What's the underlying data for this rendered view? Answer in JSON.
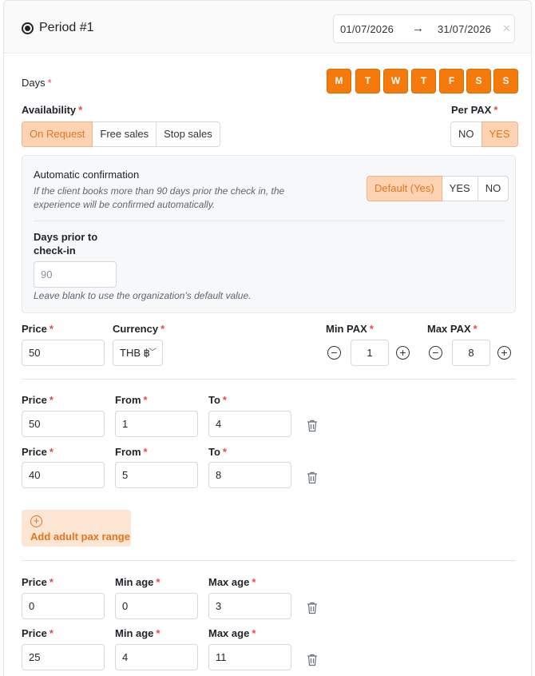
{
  "period": {
    "title": "Period #1",
    "date_start": "01/07/2026",
    "date_end": "31/07/2026"
  },
  "days": {
    "label": "Days",
    "required": "*",
    "items": [
      "M",
      "T",
      "W",
      "T",
      "F",
      "S",
      "S"
    ]
  },
  "availability": {
    "label": "Availability",
    "options": [
      "On Request",
      "Free sales",
      "Stop sales"
    ],
    "selected": "On Request"
  },
  "per_pax": {
    "label": "Per PAX",
    "options": [
      "NO",
      "YES"
    ],
    "selected": "YES"
  },
  "auto_confirmation": {
    "title": "Automatic confirmation",
    "hint_line1": "If the client books more than 90 days prior the check in, the",
    "hint_line2": "experience will be confirmed automatically.",
    "options": [
      "Default (Yes)",
      "YES",
      "NO"
    ],
    "selected": "Default (Yes)",
    "days_label_line1": "Days prior to",
    "days_label_line2": "check-in",
    "days_placeholder": "90",
    "days_hint": "Leave blank to use the organization's default value."
  },
  "pricing": {
    "price_label": "Price",
    "price_value": "50",
    "currency_label": "Currency",
    "currency_value": "THB ฿",
    "min_pax_label": "Min PAX",
    "min_pax_value": "1",
    "max_pax_label": "Max PAX",
    "max_pax_value": "8"
  },
  "adult_ranges": {
    "price_label": "Price",
    "from_label": "From",
    "to_label": "To",
    "rows": [
      {
        "price": "50",
        "from": "1",
        "to": "4"
      },
      {
        "price": "40",
        "from": "5",
        "to": "8"
      }
    ],
    "add_label": "Add adult pax range"
  },
  "child_ranges": {
    "price_label": "Price",
    "min_age_label": "Min age",
    "max_age_label": "Max age",
    "rows": [
      {
        "price": "0",
        "min_age": "0",
        "max_age": "3"
      },
      {
        "price": "25",
        "min_age": "4",
        "max_age": "11"
      }
    ]
  },
  "colors": {
    "accent": "#f47a0b",
    "accent_soft": "#fdd3b4",
    "required": "#e5484d"
  }
}
